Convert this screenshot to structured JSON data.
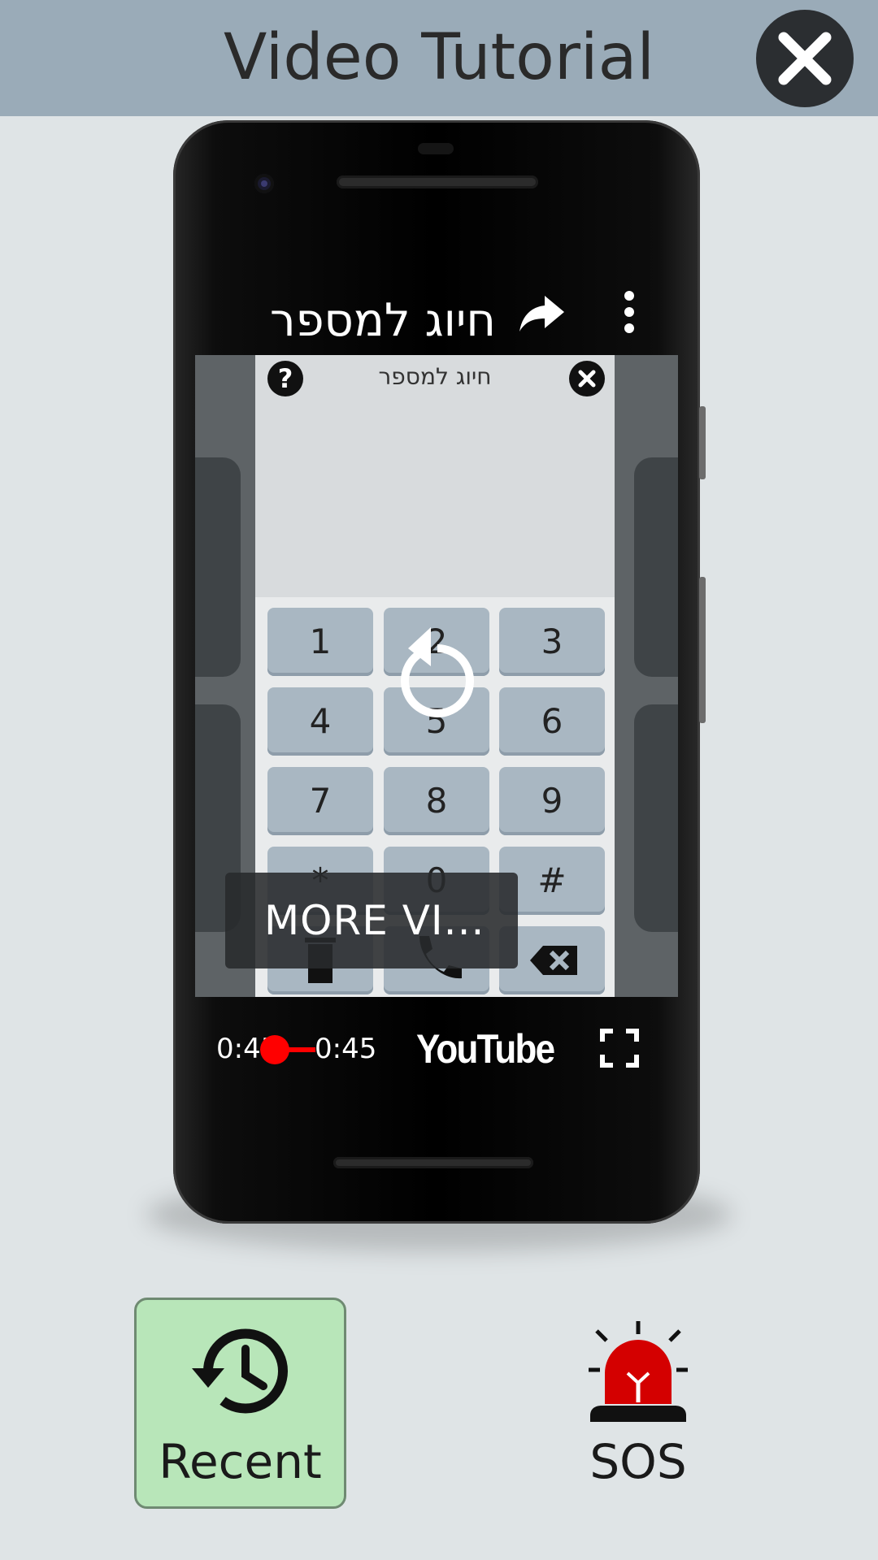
{
  "header": {
    "title": "Video Tutorial",
    "close_icon": "close-icon",
    "background": "#9aabb8"
  },
  "video": {
    "title": "חיוג למספר",
    "share_icon": "share-icon",
    "more_icon": "more-vert-icon",
    "inner_app": {
      "title": "חיוג למספר",
      "help_label": "?",
      "keys": [
        "1",
        "2",
        "3",
        "4",
        "5",
        "6",
        "7",
        "8",
        "9",
        "*",
        "0",
        "#"
      ],
      "bottom_icons": [
        "trash-icon",
        "phone-icon",
        "backspace-icon"
      ]
    },
    "replay_icon": "replay-icon",
    "more_videos_label": "MORE VI...",
    "time_current": "0:45",
    "time_total": "0:45",
    "progress_fraction": 1.0,
    "brand": "YouTube",
    "fullscreen_icon": "fullscreen-icon"
  },
  "bottom": {
    "recent_label": "Recent",
    "recent_icon": "history-icon",
    "recent_color": "#b8e6b9",
    "sos_label": "SOS",
    "sos_icon": "siren-icon",
    "sos_color": "#d40000"
  }
}
